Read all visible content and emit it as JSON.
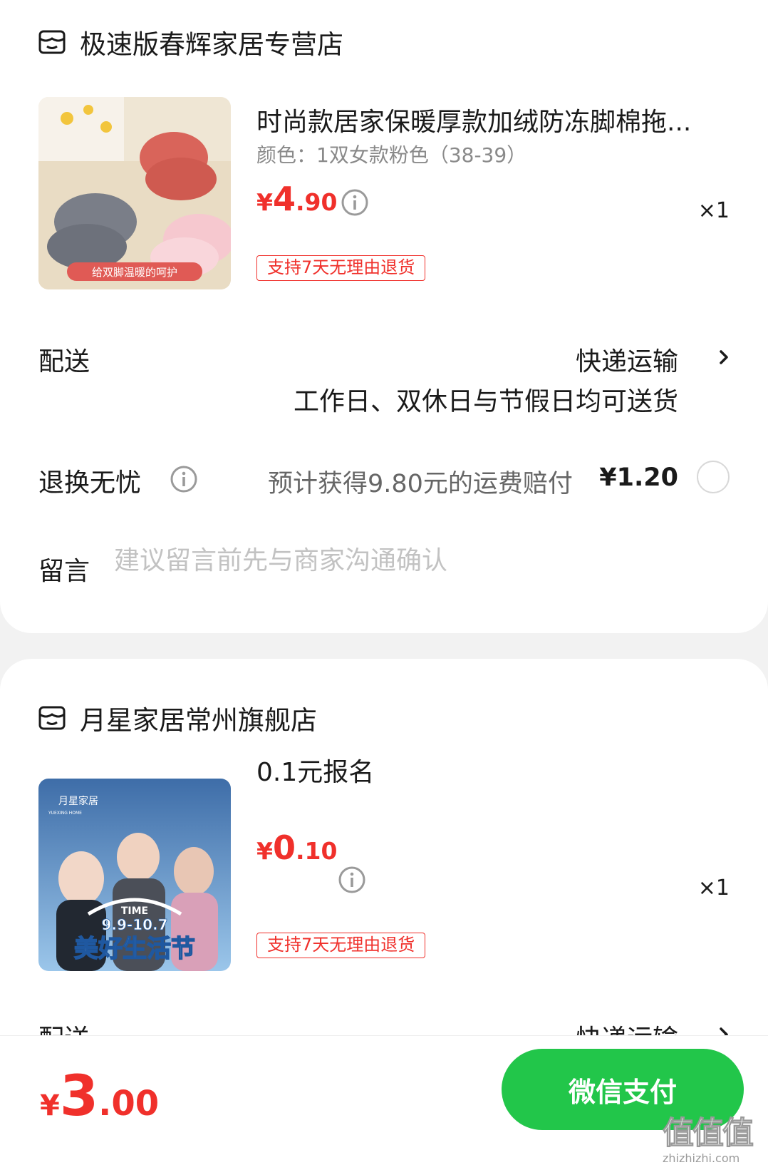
{
  "stores": [
    {
      "name": "极速版春辉家居专营店",
      "product": {
        "title": "时尚款居家保暖厚款加绒防冻脚棉拖...",
        "variant": "颜色：1双女款粉色（38-39）",
        "price_symbol": "¥",
        "price_int": "4",
        "price_dec": ".90",
        "quantity": "×1",
        "tag": "支持7天无理由退货",
        "image_banner": "给双脚温暖的呵护"
      },
      "delivery": {
        "label": "配送",
        "method": "快递运输",
        "note": "工作日、双休日与节假日均可送货"
      },
      "return_service": {
        "label": "退换无忧",
        "note": "预计获得9.80元的运费赔付",
        "price": "¥1.20",
        "selected": false
      },
      "message": {
        "label": "留言",
        "placeholder": "建议留言前先与商家沟通确认"
      }
    },
    {
      "name": "月星家居常州旗舰店",
      "product": {
        "title": "0.1元报名",
        "price_symbol": "¥",
        "price_int": "0",
        "price_dec": ".10",
        "quantity": "×1",
        "tag": "支持7天无理由退货",
        "image_brand": "月星家居",
        "image_brand_en": "YUEXING HOME",
        "image_time": "TIME",
        "image_dates": "9.9-10.7",
        "image_title": "美好生活节"
      },
      "delivery": {
        "label": "配送",
        "method": "快递运输"
      }
    }
  ],
  "footer": {
    "total_symbol": "¥",
    "total_int": "3",
    "total_dec": ".00",
    "pay_button": "微信支付"
  },
  "watermark": {
    "logo": "值值值",
    "url": "zhizhizhi.com"
  },
  "icons": {
    "store": "store-icon",
    "info": "info-icon",
    "chevron": "chevron-right-icon"
  },
  "colors": {
    "accent_red": "#f0302b",
    "pay_green": "#22c64a"
  }
}
